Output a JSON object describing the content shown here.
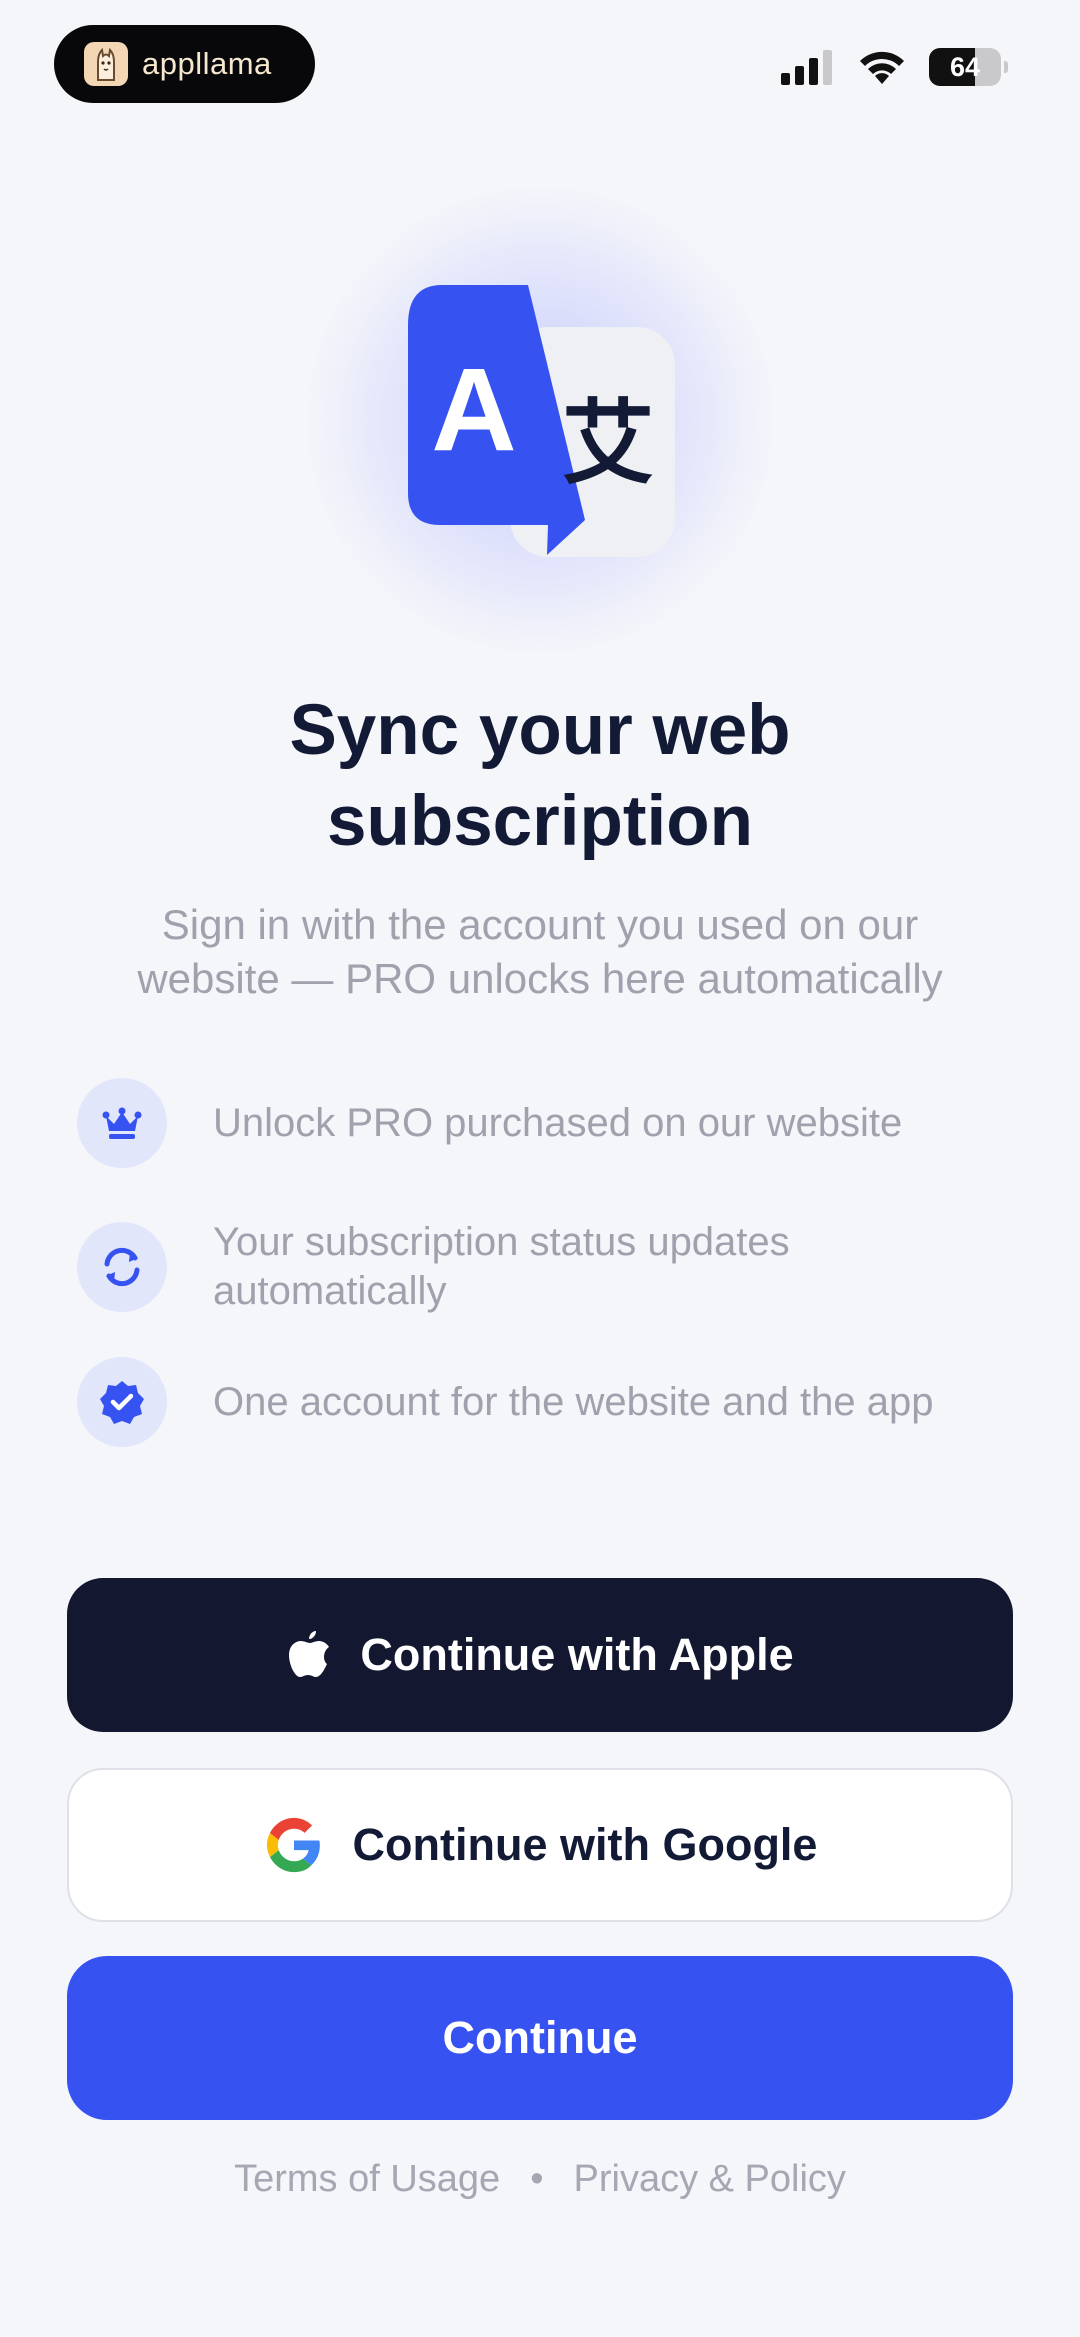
{
  "status_bar": {
    "brand_name": "appllama",
    "battery_level": 64,
    "battery_label": "64",
    "icons": [
      "signal-icon",
      "wifi-icon",
      "battery-icon"
    ]
  },
  "hero": {
    "icon": "translate-icon",
    "latin_glyph": "A",
    "cjk_glyph": "艾",
    "colors": {
      "primary": "#3652f0",
      "secondary": "#eef0f4"
    }
  },
  "title": {
    "line1": "Sync your web",
    "line2": "subscription"
  },
  "subtitle": {
    "line1": "Sign in with the account you used on our",
    "line2": "website — PRO unlocks here automatically"
  },
  "features": [
    {
      "icon": "crown-icon",
      "text": "Unlock PRO purchased on our website"
    },
    {
      "icon": "sync-icon",
      "line1": "Your subscription status updates",
      "line2": "automatically"
    },
    {
      "icon": "verified-badge-icon",
      "text": "One account for the website and the app"
    }
  ],
  "buttons": {
    "apple": "Continue with Apple",
    "google": "Continue with Google",
    "continue": "Continue"
  },
  "footer": {
    "terms": "Terms of Usage",
    "separator": "•",
    "privacy": "Privacy & Policy"
  },
  "colors": {
    "accent": "#3652f0",
    "dark_button": "#131830",
    "title_text": "#131a35",
    "muted_text": "#9fa1ad",
    "background": "#f5f6fa"
  }
}
